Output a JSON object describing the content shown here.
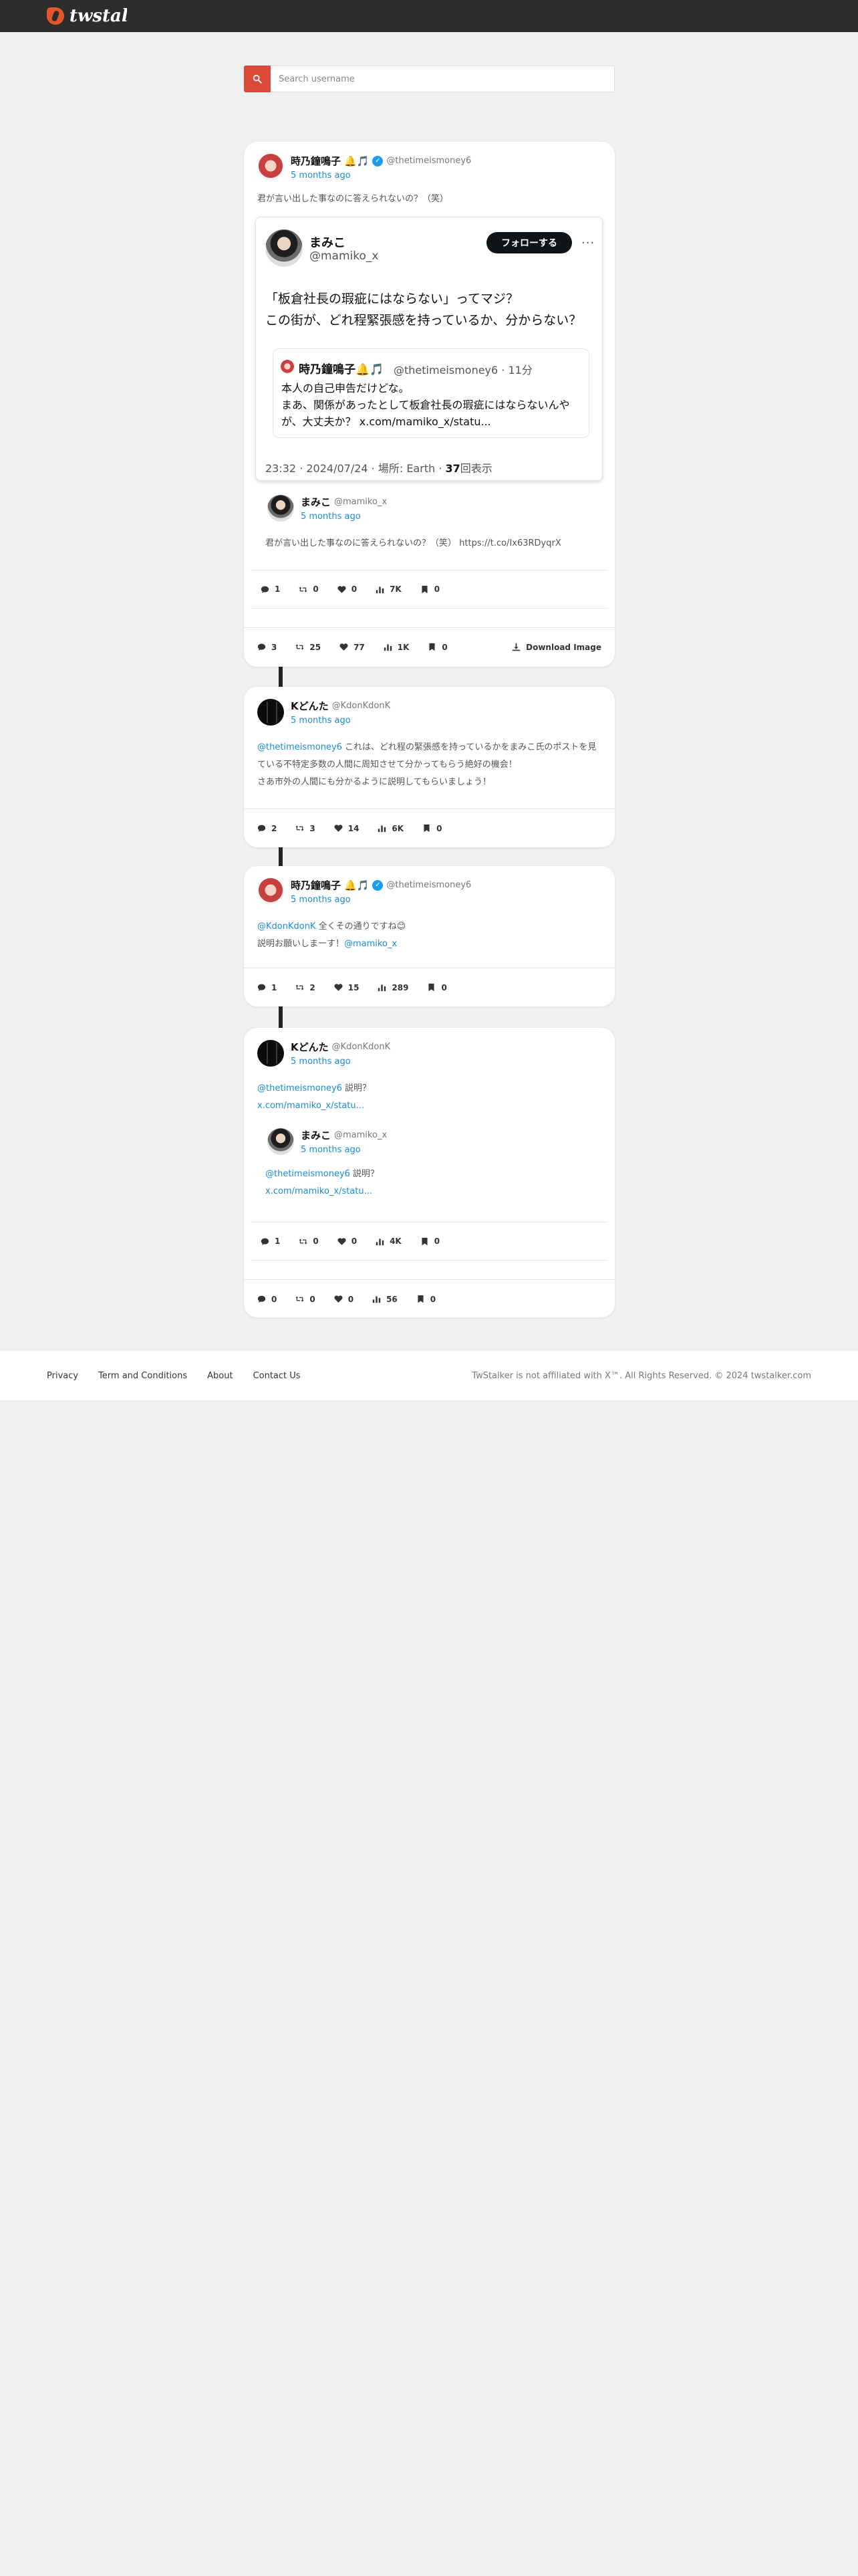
{
  "header": {
    "logo_text": "twstalker"
  },
  "search": {
    "placeholder": "Search username"
  },
  "main_tweet": {
    "name": "時乃鐘鳴子",
    "name_suffix": "🔔🎵",
    "handle": "@thetimeismoney6",
    "time": "5 months ago",
    "text": "君が言い出した事なのに答えられないの？（笑）",
    "embed": {
      "name": "まみこ",
      "handle": "@mamiko_x",
      "follow_label": "フォローする",
      "text": "「板倉社長の瑕疵にはならない」ってマジ？\nこの街が、どれ程緊張感を持っているか、分からない？",
      "quote_name": "時乃鐘鳴子🔔🎵",
      "quote_handle": "@thetimeismoney6 · 11分",
      "quote_text": "本人の自己申告だけどな。\nまあ、関係があったとして板倉社長の瑕疵にはならないんやが、大丈夫か？ x.com/mamiko_x/statu...",
      "meta_prefix": "23:32 · 2024/07/24 · 場所: Earth · ",
      "meta_views": "37",
      "meta_suffix": "回表示"
    },
    "inner": {
      "name": "まみこ",
      "handle": "@mamiko_x",
      "time": "5 months ago",
      "text": "君が言い出した事なのに答えられないの？（笑） https://t.co/Ix63RDyqrX",
      "stats": {
        "replies": "1",
        "retweets": "0",
        "likes": "0",
        "views": "7K",
        "bookmarks": "0"
      }
    },
    "stats": {
      "replies": "3",
      "retweets": "25",
      "likes": "77",
      "views": "1K",
      "bookmarks": "0"
    },
    "download_label": "Download Image"
  },
  "reply1": {
    "name": "Kどんた",
    "handle": "@KdonKdonK",
    "time": "5 months ago",
    "mention": "@thetimeismoney6",
    "text_line1": " これは、どれ程の緊張感を持っているかをまみこ氏のポストを見ている不特定多数の人間に周知させて分かってもらう絶好の機会！",
    "text_line2": "さあ市外の人間にも分かるように説明してもらいましょう！",
    "stats": {
      "replies": "2",
      "retweets": "3",
      "likes": "14",
      "views": "6K",
      "bookmarks": "0"
    }
  },
  "reply2": {
    "name": "時乃鐘鳴子",
    "name_suffix": "🔔🎵",
    "handle": "@thetimeismoney6",
    "time": "5 months ago",
    "mention1": "@KdonKdonK",
    "text_line1": " 全くその通りですね😊",
    "text_line2": "説明お願いしまーす！",
    "mention2": "@mamiko_x",
    "stats": {
      "replies": "1",
      "retweets": "2",
      "likes": "15",
      "views": "289",
      "bookmarks": "0"
    }
  },
  "reply3": {
    "name": "Kどんた",
    "handle": "@KdonKdonK",
    "time": "5 months ago",
    "mention": "@thetimeismoney6",
    "text_after": " 説明？",
    "link": "x.com/mamiko_x/statu...",
    "inner": {
      "name": "まみこ",
      "handle": "@mamiko_x",
      "time": "5 months ago",
      "mention": "@thetimeismoney6",
      "text_after": " 説明？",
      "link": "x.com/mamiko_x/statu...",
      "stats": {
        "replies": "1",
        "retweets": "0",
        "likes": "0",
        "views": "4K",
        "bookmarks": "0"
      }
    },
    "stats": {
      "replies": "0",
      "retweets": "0",
      "likes": "0",
      "views": "56",
      "bookmarks": "0"
    }
  },
  "footer": {
    "links": [
      "Privacy",
      "Term and Conditions",
      "About",
      "Contact Us"
    ],
    "copyright": "TwStalker is not affiliated with X™. All Rights Reserved. © 2024 twstalker.com"
  }
}
